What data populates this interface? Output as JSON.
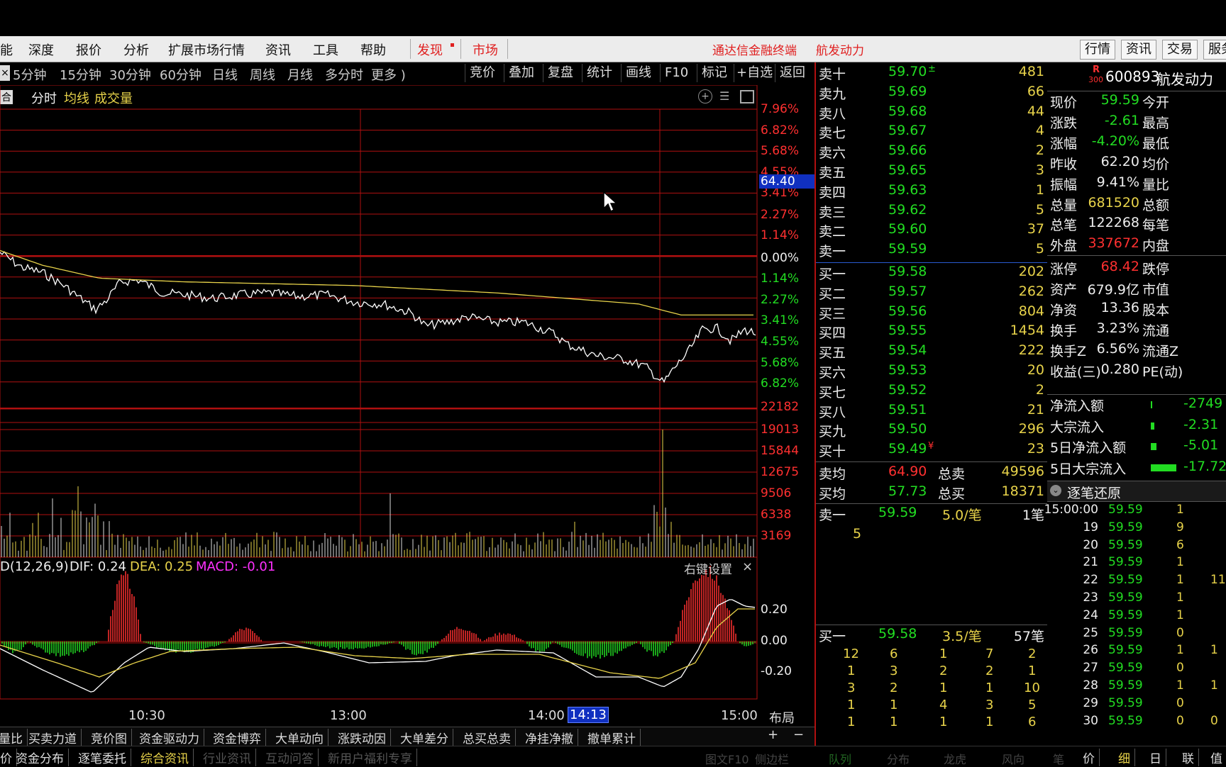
{
  "menubar": {
    "items": [
      "能",
      "深度",
      "报价",
      "分析",
      "扩展市场行情",
      "资讯",
      "工具",
      "帮助"
    ],
    "discover": "发现",
    "market": "市场",
    "center_title": "通达信金融终端",
    "stock_name_title": "航发动力",
    "right_buttons": [
      "行情",
      "资讯",
      "交易",
      "服务"
    ]
  },
  "period_tabs": [
    "5分钟",
    "15分钟",
    "30分钟",
    "60分钟",
    "日线",
    "周线",
    "月线",
    "多分时",
    "更多 )"
  ],
  "toolbar_buttons": [
    "竞价",
    "叠加",
    "复盘",
    "统计",
    "画线",
    "F10",
    "标记",
    "+自选",
    "返回"
  ],
  "chart_header": {
    "box_label": "合",
    "mode": "分时",
    "avg_label": "均线",
    "vol_label": "成交量"
  },
  "price_axis": {
    "upper": [
      "7.96%",
      "6.82%",
      "5.68%",
      "4.55%",
      "3.41%",
      "2.27%",
      "1.14%"
    ],
    "zero": "0.00%",
    "lower": [
      "1.14%",
      "2.27%",
      "3.41%",
      "4.55%",
      "5.68%",
      "6.82%"
    ],
    "cursor_price": "64.40"
  },
  "volume_axis": [
    "22182",
    "19013",
    "15844",
    "12675",
    "9506",
    "6338",
    "3169"
  ],
  "macd": {
    "name": "D(12,26,9)",
    "dif_label": "DIF: 0.24",
    "dea_label": "DEA: 0.25",
    "macd_label": "MACD: -0.01",
    "settings_label": "右键设置",
    "close_icon": "×",
    "axis": [
      "0.20",
      "0.00",
      "-0.20"
    ]
  },
  "time_axis": {
    "labels": [
      "10:30",
      "13:00",
      "14:00",
      "15:00"
    ],
    "cursor_time": "14:13",
    "layout_btn": "布局"
  },
  "bottom_tabs_row1": [
    "量比",
    "买卖力道",
    "竞价图",
    "资金驱动力",
    "资金博弈",
    "大单动向",
    "涨跌动因",
    "大单差分",
    "总买总卖",
    "净挂净撤",
    "撤单累计"
  ],
  "bottom_tabs_row2": [
    "价",
    "资金分布",
    "逐笔委托",
    "综合资讯",
    "行业资讯",
    "互动问答",
    "新用户福利专享"
  ],
  "bottom_right_tabs": [
    "图文F10",
    "侧边栏",
    "队列",
    "分布",
    "龙虎",
    "风向",
    "笔",
    "价",
    "细",
    "日",
    "联",
    "值"
  ],
  "plus_minus": [
    "+",
    "−"
  ],
  "orderbook": {
    "asks": [
      {
        "label": "卖十",
        "price": "59.70",
        "vol": "481",
        "mark": "±"
      },
      {
        "label": "卖九",
        "price": "59.69",
        "vol": "66"
      },
      {
        "label": "卖八",
        "price": "59.68",
        "vol": "44"
      },
      {
        "label": "卖七",
        "price": "59.67",
        "vol": "4"
      },
      {
        "label": "卖六",
        "price": "59.66",
        "vol": "2"
      },
      {
        "label": "卖五",
        "price": "59.65",
        "vol": "3"
      },
      {
        "label": "卖四",
        "price": "59.63",
        "vol": "1"
      },
      {
        "label": "卖三",
        "price": "59.62",
        "vol": "5"
      },
      {
        "label": "卖二",
        "price": "59.60",
        "vol": "37"
      },
      {
        "label": "卖一",
        "price": "59.59",
        "vol": "5"
      }
    ],
    "bids": [
      {
        "label": "买一",
        "price": "59.58",
        "vol": "202"
      },
      {
        "label": "买二",
        "price": "59.57",
        "vol": "262"
      },
      {
        "label": "买三",
        "price": "59.56",
        "vol": "804"
      },
      {
        "label": "买四",
        "price": "59.55",
        "vol": "1454"
      },
      {
        "label": "买五",
        "price": "59.54",
        "vol": "222"
      },
      {
        "label": "买六",
        "price": "59.53",
        "vol": "20"
      },
      {
        "label": "买七",
        "price": "59.52",
        "vol": "2"
      },
      {
        "label": "买八",
        "price": "59.51",
        "vol": "21"
      },
      {
        "label": "买九",
        "price": "59.50",
        "vol": "296"
      },
      {
        "label": "买十",
        "price": "59.49",
        "vol": "23",
        "mark": "¥"
      }
    ],
    "avg_sell": {
      "label": "卖均",
      "price": "64.90",
      "total_label": "总卖",
      "total": "49596"
    },
    "avg_buy": {
      "label": "买均",
      "price": "57.73",
      "total_label": "总买",
      "total": "18371"
    },
    "sell1_queue": {
      "label": "卖一",
      "price": "59.59",
      "per": "5.0/笔",
      "count": "1笔",
      "items": [
        "5"
      ]
    },
    "buy1_queue": {
      "label": "买一",
      "price": "59.58",
      "per": "3.5/笔",
      "count": "57笔",
      "rows": [
        [
          "12",
          "6",
          "1",
          "7",
          "2"
        ],
        [
          "1",
          "3",
          "2",
          "2",
          "1"
        ],
        [
          "3",
          "2",
          "1",
          "1",
          "10"
        ],
        [
          "1",
          "1",
          "4",
          "3",
          "5"
        ],
        [
          "1",
          "1",
          "1",
          "1",
          "6"
        ]
      ]
    }
  },
  "stock": {
    "badge_top": "R",
    "badge_bottom": "300",
    "code": "600893",
    "name": "航发动力",
    "rows": [
      {
        "k": "现价",
        "v": "59.59",
        "k2": "今开",
        "c": "green"
      },
      {
        "k": "涨跌",
        "v": "-2.61",
        "k2": "最高",
        "c": "green"
      },
      {
        "k": "涨幅",
        "v": "-4.20%",
        "k2": "最低",
        "c": "green"
      },
      {
        "k": "昨收",
        "v": "62.20",
        "k2": "均价",
        "c": "white"
      },
      {
        "k": "振幅",
        "v": "9.41%",
        "k2": "量比",
        "c": "white"
      },
      {
        "k": "总量",
        "v": "681520",
        "k2": "总额",
        "c": "yellow"
      },
      {
        "k": "总笔",
        "v": "122268",
        "k2": "每笔",
        "c": "white"
      },
      {
        "k": "外盘",
        "v": "337672",
        "k2": "内盘",
        "c": "red"
      },
      {
        "k": "涨停",
        "v": "68.42",
        "k2": "跌停",
        "c": "red"
      },
      {
        "k": "资产",
        "v": "679.9亿",
        "k2": "市值",
        "c": "white"
      },
      {
        "k": "净资",
        "v": "13.36",
        "k2": "股本",
        "c": "white"
      },
      {
        "k": "换手",
        "v": "3.23%",
        "k2": "流通",
        "c": "white"
      },
      {
        "k": "换手Z",
        "v": "6.56%",
        "k2": "流通Z",
        "c": "white"
      },
      {
        "k": "收益(三)",
        "v": "0.280",
        "k2": "PE(动)",
        "c": "white"
      }
    ],
    "flows": [
      {
        "k": "净流入额",
        "v": "-2749"
      },
      {
        "k": "大宗流入",
        "v": "-2.31"
      },
      {
        "k": "5日净流入额",
        "v": "-5.01"
      },
      {
        "k": "5日大宗流入",
        "v": "-17.72"
      }
    ]
  },
  "ticks": {
    "header": "逐笔还原",
    "rows": [
      {
        "t": "15:00:00",
        "p": "59.59",
        "v": "1",
        "x": ""
      },
      {
        "t": "19",
        "p": "59.59",
        "v": "9",
        "x": ""
      },
      {
        "t": "20",
        "p": "59.59",
        "v": "6",
        "x": ""
      },
      {
        "t": "21",
        "p": "59.59",
        "v": "1",
        "x": ""
      },
      {
        "t": "22",
        "p": "59.59",
        "v": "1",
        "x": "11"
      },
      {
        "t": "23",
        "p": "59.59",
        "v": "1",
        "x": ""
      },
      {
        "t": "24",
        "p": "59.59",
        "v": "1",
        "x": ""
      },
      {
        "t": "25",
        "p": "59.59",
        "v": "0",
        "x": ""
      },
      {
        "t": "26",
        "p": "59.59",
        "v": "1",
        "x": "1"
      },
      {
        "t": "27",
        "p": "59.59",
        "v": "0",
        "x": ""
      },
      {
        "t": "28",
        "p": "59.59",
        "v": "1",
        "x": "1"
      },
      {
        "t": "29",
        "p": "59.59",
        "v": "0",
        "x": ""
      },
      {
        "t": "30",
        "p": "59.59",
        "v": "0",
        "x": "0"
      }
    ]
  },
  "colors": {
    "grid": "#b01010",
    "price_line": "#ffffff",
    "avg_line": "#e8d34a",
    "up": "#ff3030",
    "down": "#22dd22"
  },
  "icons": [
    "add-icon",
    "list-icon",
    "window-icon",
    "close-icon",
    "cursor-icon",
    "chevron-down-icon"
  ]
}
